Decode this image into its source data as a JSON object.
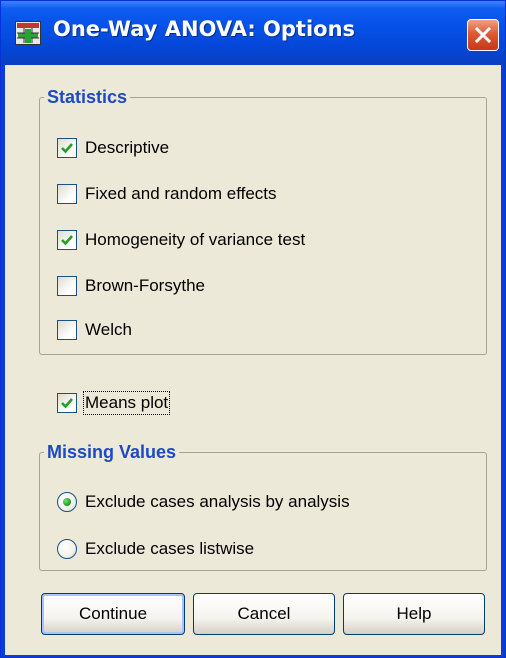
{
  "window": {
    "title": "One-Way ANOVA: Options"
  },
  "statistics": {
    "legend": "Statistics",
    "items": [
      {
        "label": "Descriptive",
        "checked": true
      },
      {
        "label": "Fixed and random effects",
        "checked": false
      },
      {
        "label": "Homogeneity of variance test",
        "checked": true
      },
      {
        "label": "Brown-Forsythe",
        "checked": false
      },
      {
        "label": "Welch",
        "checked": false
      }
    ]
  },
  "means_plot": {
    "label": "Means plot",
    "checked": true
  },
  "missing_values": {
    "legend": "Missing Values",
    "options": [
      {
        "label": "Exclude cases analysis by analysis",
        "selected": true
      },
      {
        "label": "Exclude cases listwise",
        "selected": false
      }
    ]
  },
  "buttons": {
    "continue": "Continue",
    "cancel": "Cancel",
    "help": "Help"
  },
  "colors": {
    "titlebar": "#0651e8",
    "legend_text": "#1e49c3",
    "dialog_bg": "#ece9d8",
    "close_button": "#dd5a35"
  },
  "icons": {
    "app": "spss-grid-icon",
    "close": "close-icon",
    "check": "checkmark-icon"
  }
}
